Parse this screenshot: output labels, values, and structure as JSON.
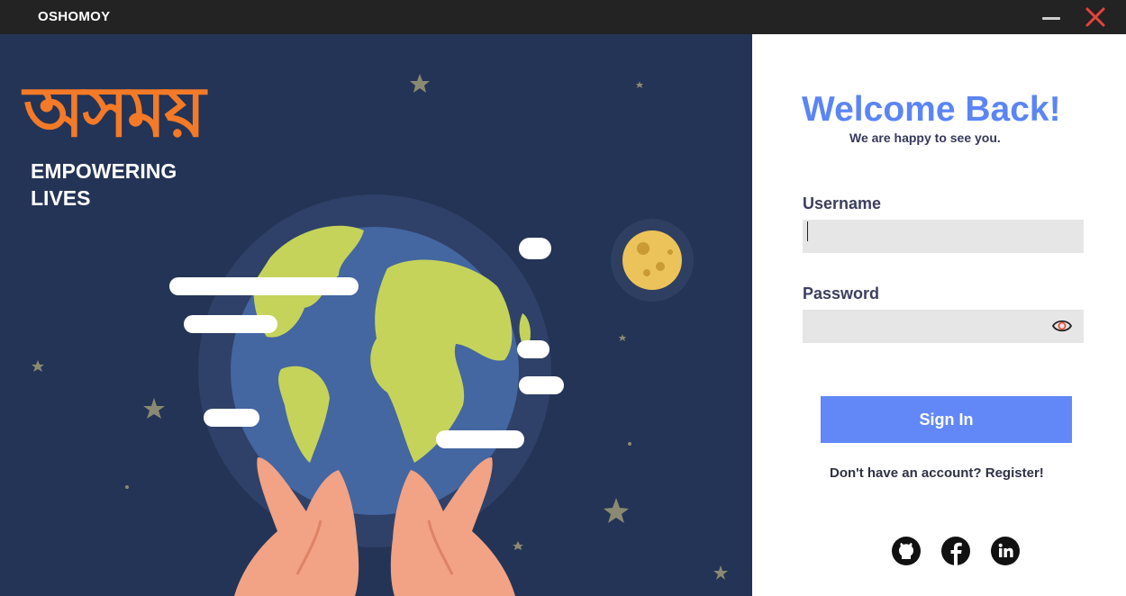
{
  "window": {
    "title": "OSHOMOY"
  },
  "brand": {
    "logo_text": "অসময়",
    "tagline_line1": "EMPOWERING",
    "tagline_line2": "LIVES"
  },
  "login": {
    "heading": "Welcome Back!",
    "subheading": "We are happy to see you.",
    "username_label": "Username",
    "username_value": "",
    "password_label": "Password",
    "password_value": "",
    "sign_in_label": "Sign In",
    "register_text": "Don't have an account? Register!"
  },
  "social": [
    "github-icon",
    "facebook-icon",
    "linkedin-icon"
  ],
  "colors": {
    "accent": "#5b85f5",
    "button": "#6288f7",
    "logo": "#f47a27",
    "panel": "#243456",
    "titlebar": "#232323",
    "close": "#e8423a"
  }
}
